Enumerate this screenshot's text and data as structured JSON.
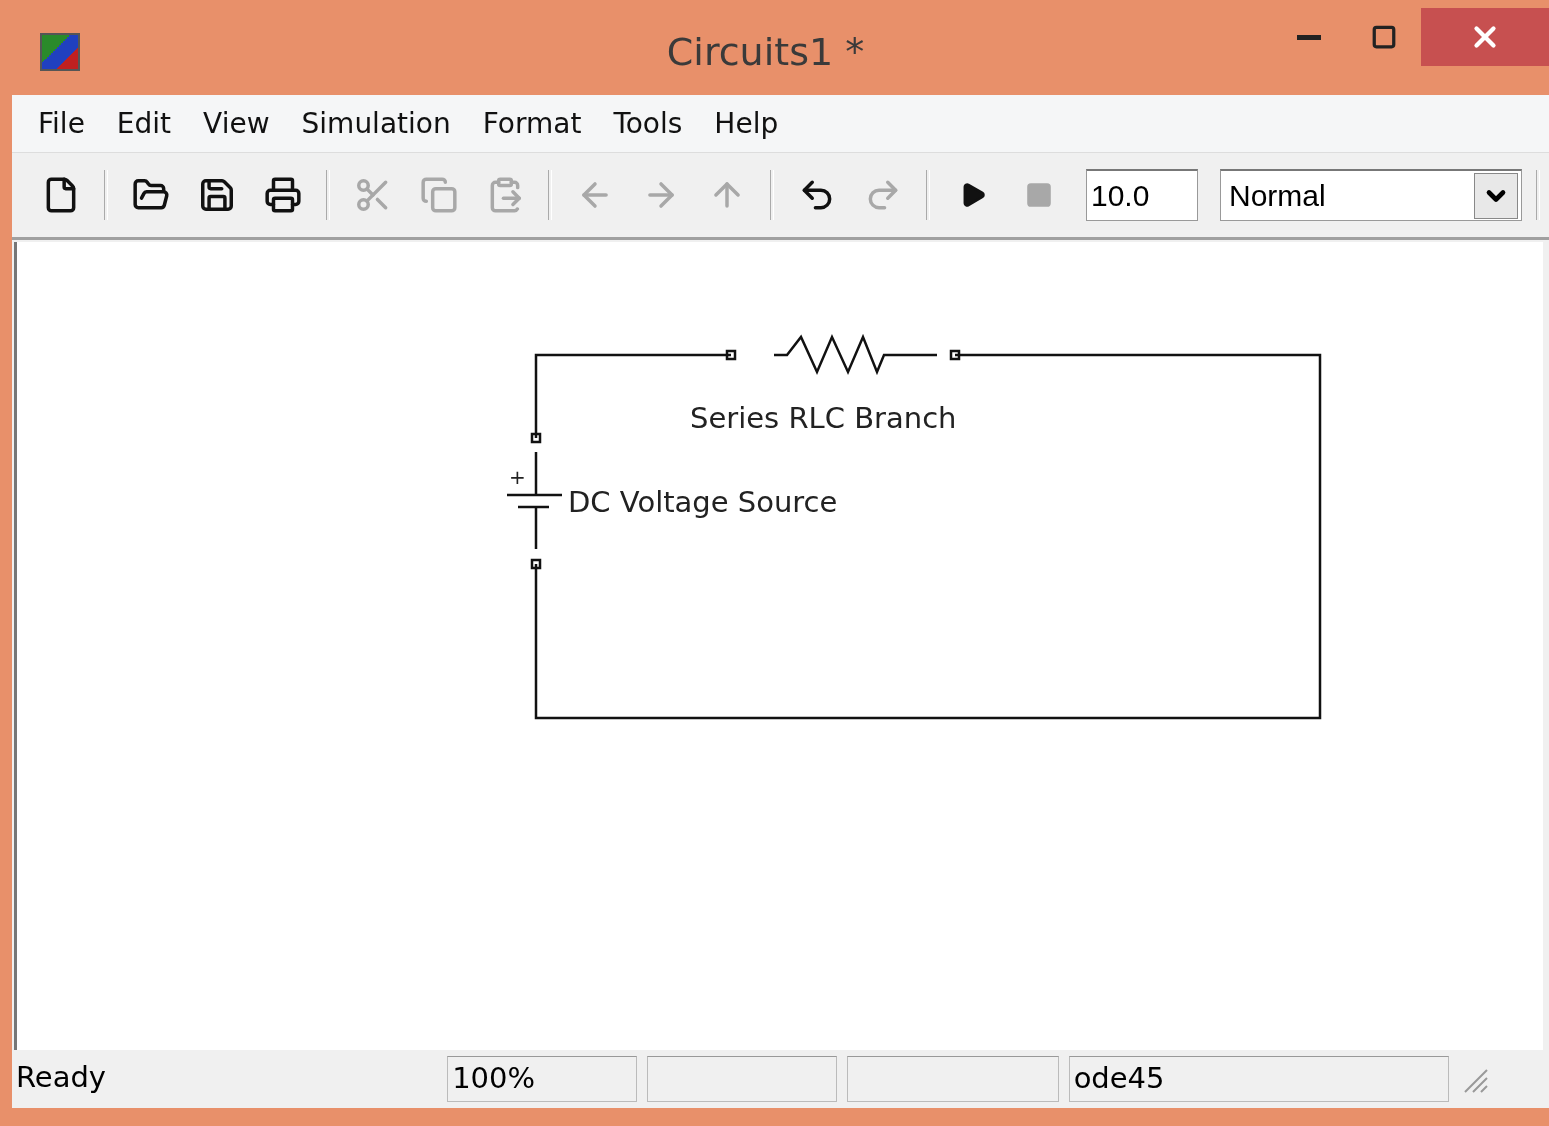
{
  "window": {
    "title": "Circuits1 *"
  },
  "menu": [
    {
      "label": "File"
    },
    {
      "label": "Edit"
    },
    {
      "label": "View"
    },
    {
      "label": "Simulation"
    },
    {
      "label": "Format"
    },
    {
      "label": "Tools"
    },
    {
      "label": "Help"
    }
  ],
  "toolbar": {
    "groups": [
      [
        {
          "kind": "new",
          "disabled": false
        }
      ],
      [
        {
          "kind": "open",
          "disabled": false
        },
        {
          "kind": "save",
          "disabled": false
        },
        {
          "kind": "print",
          "disabled": false
        }
      ],
      [
        {
          "kind": "cut",
          "disabled": true
        },
        {
          "kind": "copy",
          "disabled": true
        },
        {
          "kind": "paste",
          "disabled": true
        }
      ],
      [
        {
          "kind": "back",
          "disabled": true
        },
        {
          "kind": "forward",
          "disabled": true
        },
        {
          "kind": "up",
          "disabled": true
        }
      ],
      [
        {
          "kind": "undo",
          "disabled": false
        },
        {
          "kind": "redo",
          "disabled": true
        }
      ],
      [
        {
          "kind": "play",
          "disabled": false
        },
        {
          "kind": "stop",
          "disabled": true
        }
      ]
    ],
    "stop_time": "10.0",
    "mode": "Normal"
  },
  "diagram": {
    "blocks": [
      {
        "kind": "resistor",
        "label": "Series RLC Branch"
      },
      {
        "kind": "battery",
        "label": "DC Voltage Source",
        "polarity": "+"
      }
    ]
  },
  "status_bar": {
    "message": "Ready",
    "zoom": "100%",
    "solver": "ode45"
  }
}
